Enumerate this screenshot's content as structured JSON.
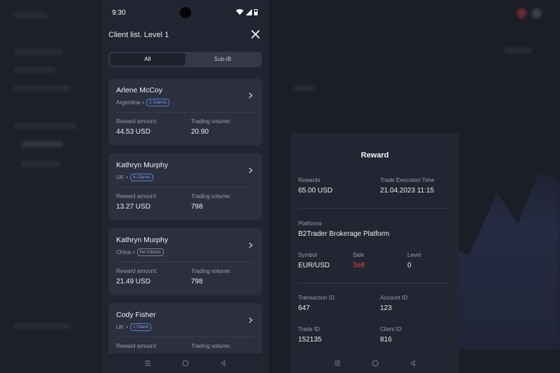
{
  "status_bar": {
    "time": "9:30"
  },
  "panel": {
    "title": "Client list. Level 1",
    "segments": [
      {
        "label": "All",
        "active": true
      },
      {
        "label": "Sub-IB",
        "active": false
      }
    ]
  },
  "clients": [
    {
      "name": "Arlene McCoy",
      "country": "Argentina",
      "badge": "2 Clients",
      "reward_label": "Reward amount:",
      "reward": "44.53 USD",
      "volume_label": "Trading volume:",
      "volume": "20.90"
    },
    {
      "name": "Kathryn Murphy",
      "country": "UK",
      "badge": "8 Clients",
      "reward_label": "Reward amount:",
      "reward": "13.27 USD",
      "volume_label": "Trading volume:",
      "volume": "798"
    },
    {
      "name": "Kathryn Murphy",
      "country": "China",
      "badge": "No Clients",
      "reward_label": "Reward amount:",
      "reward": "21.49 USD",
      "volume_label": "Trading volume:",
      "volume": "798"
    },
    {
      "name": "Cody Fisher",
      "country": "UK",
      "badge": "1 Client",
      "reward_label": "Reward amount:",
      "reward": "",
      "volume_label": "Trading volume:",
      "volume": ""
    }
  ],
  "reward": {
    "title": "Reward",
    "rewards_label": "Rewards",
    "rewards": "65.00 USD",
    "time_label": "Trade Execution Time",
    "time": "21.04.2023 11:15",
    "platforms_label": "Platforms",
    "platforms": "B2Trader Brokerage Platform",
    "symbol_label": "Symbol",
    "symbol": "EUR/USD",
    "side_label": "Side",
    "side": "Sell",
    "level_label": "Level",
    "level": "0",
    "transaction_label": "Transaction ID",
    "transaction": "647",
    "account_label": "Account ID",
    "account": "123",
    "trade_label": "Trade ID",
    "trade": "152135",
    "client_label": "Client ID",
    "client": "816"
  },
  "colors": {
    "accent": "#5b7fd6",
    "sell": "#e2463f",
    "card": "#2c2f3d",
    "panel": "#222431"
  },
  "icons": [
    "wifi-icon",
    "signal-icon",
    "battery-icon",
    "close-icon",
    "chevron-right-icon",
    "menu-icon",
    "home-icon",
    "back-icon"
  ]
}
